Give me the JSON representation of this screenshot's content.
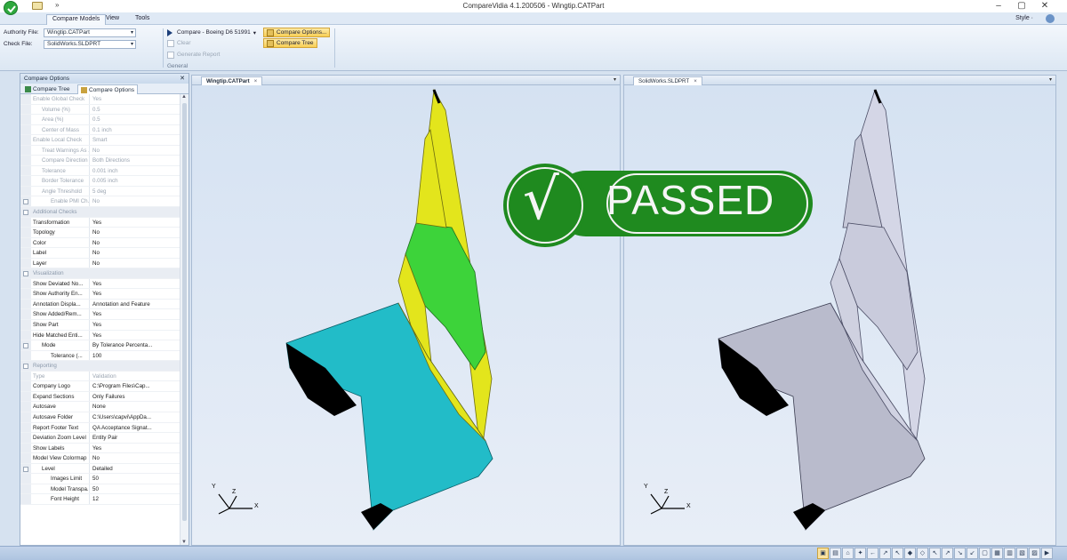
{
  "window": {
    "title": "CompareVidia 4.1.200506 - Wingtip.CATPart",
    "qa_label": "»",
    "min": "–",
    "max": "▢",
    "close": "✕"
  },
  "ribbon_tabs": [
    "Compare Models",
    "View",
    "Tools"
  ],
  "style_label": "Style ·",
  "ribbon": {
    "authority_label": "Authority File:",
    "authority_value": "Wingtip.CATPart",
    "check_label": "Check File:",
    "check_value": "SolidWorks.SLDPRT",
    "compare_label": "Compare - Boeing D6 51991",
    "clear_label": "Clear",
    "generate_report_label": "Generate Report",
    "compare_options_label": "Compare Options...",
    "compare_tree_label": "Compare Tree",
    "group_caption": "General"
  },
  "left_panel": {
    "title": "Compare Options",
    "close": "✕",
    "tabs": [
      "Compare Tree",
      "Compare Options"
    ],
    "rows": [
      {
        "name": "Enable Global Check",
        "value": "Yes",
        "indent": 0,
        "disabled": true,
        "cat": false
      },
      {
        "name": "Volume (%)",
        "value": "0.5",
        "indent": 1,
        "disabled": true,
        "cat": false
      },
      {
        "name": "Area (%)",
        "value": "0.5",
        "indent": 1,
        "disabled": true,
        "cat": false
      },
      {
        "name": "Center of Mass",
        "value": "0.1 inch",
        "indent": 1,
        "disabled": true,
        "cat": false
      },
      {
        "name": "Enable Local Check",
        "value": "Smart",
        "indent": 0,
        "disabled": true,
        "cat": false
      },
      {
        "name": "Treat Warnings As ...",
        "value": "No",
        "indent": 1,
        "disabled": true,
        "cat": false
      },
      {
        "name": "Compare Direction",
        "value": "Both Directions",
        "indent": 1,
        "disabled": true,
        "cat": false
      },
      {
        "name": "Tolerance",
        "value": "0.001 inch",
        "indent": 1,
        "disabled": true,
        "cat": false
      },
      {
        "name": "Border Tolerance",
        "value": "0.005 inch",
        "indent": 1,
        "disabled": true,
        "cat": false
      },
      {
        "name": "Angle Threshold",
        "value": "5 deg",
        "indent": 1,
        "disabled": true,
        "cat": false
      },
      {
        "name": "Enable PMI Ch...",
        "value": "No",
        "indent": 2,
        "disabled": true,
        "cat": false
      },
      {
        "name": "Additional Checks",
        "value": "",
        "indent": 0,
        "disabled": true,
        "cat": true
      },
      {
        "name": "Transformation",
        "value": "Yes",
        "indent": 0,
        "disabled": false,
        "cat": false
      },
      {
        "name": "Topology",
        "value": "No",
        "indent": 0,
        "disabled": false,
        "cat": false
      },
      {
        "name": "Color",
        "value": "No",
        "indent": 0,
        "disabled": false,
        "cat": false
      },
      {
        "name": "Label",
        "value": "No",
        "indent": 0,
        "disabled": false,
        "cat": false
      },
      {
        "name": "Layer",
        "value": "No",
        "indent": 0,
        "disabled": false,
        "cat": false
      },
      {
        "name": "Visualization",
        "value": "",
        "indent": 0,
        "disabled": true,
        "cat": true
      },
      {
        "name": "Show Deviated No...",
        "value": "Yes",
        "indent": 0,
        "disabled": false,
        "cat": false
      },
      {
        "name": "Show Authority En...",
        "value": "Yes",
        "indent": 0,
        "disabled": false,
        "cat": false
      },
      {
        "name": "Annotation Displa...",
        "value": "Annotation and Feature",
        "indent": 0,
        "disabled": false,
        "cat": false
      },
      {
        "name": "Show Added/Rem...",
        "value": "Yes",
        "indent": 0,
        "disabled": false,
        "cat": false
      },
      {
        "name": "Show Part",
        "value": "Yes",
        "indent": 0,
        "disabled": false,
        "cat": false
      },
      {
        "name": "Hide Matched Enti...",
        "value": "Yes",
        "indent": 0,
        "disabled": false,
        "cat": false
      },
      {
        "name": "Mode",
        "value": "By Tolerance Percenta...",
        "indent": 1,
        "disabled": false,
        "cat": false
      },
      {
        "name": "Tolerance (...",
        "value": "100",
        "indent": 2,
        "disabled": false,
        "cat": false
      },
      {
        "name": "Reporting",
        "value": "",
        "indent": 0,
        "disabled": true,
        "cat": true
      },
      {
        "name": "Type",
        "value": "Validation",
        "indent": 0,
        "disabled": true,
        "cat": false
      },
      {
        "name": "Company Logo",
        "value": "C:\\Program Files\\Cap...",
        "indent": 0,
        "disabled": false,
        "cat": false
      },
      {
        "name": "Expand Sections",
        "value": "Only Failures",
        "indent": 0,
        "disabled": false,
        "cat": false
      },
      {
        "name": "Autosave",
        "value": "None",
        "indent": 0,
        "disabled": false,
        "cat": false
      },
      {
        "name": "Autosave Folder",
        "value": "C:\\Users\\capvi\\AppDa...",
        "indent": 0,
        "disabled": false,
        "cat": false
      },
      {
        "name": "Report Footer Text",
        "value": "QA Acceptance Signat...",
        "indent": 0,
        "disabled": false,
        "cat": false
      },
      {
        "name": "Deviation Zoom Level",
        "value": "Entity Pair",
        "indent": 0,
        "disabled": false,
        "cat": false
      },
      {
        "name": "Show Labels",
        "value": "Yes",
        "indent": 0,
        "disabled": false,
        "cat": false
      },
      {
        "name": "Model View Colormap",
        "value": "No",
        "indent": 0,
        "disabled": false,
        "cat": false
      },
      {
        "name": "Level",
        "value": "Detailed",
        "indent": 1,
        "disabled": false,
        "cat": false
      },
      {
        "name": "Images Limit",
        "value": "50",
        "indent": 2,
        "disabled": false,
        "cat": false
      },
      {
        "name": "Model Transpa...",
        "value": "50",
        "indent": 2,
        "disabled": false,
        "cat": false
      },
      {
        "name": "Font Height",
        "value": "12",
        "indent": 2,
        "disabled": false,
        "cat": false
      }
    ]
  },
  "viewports": {
    "left_tab": "Wingtip.CATPart",
    "right_tab": "SolidWorks.SLDPRT",
    "tab_close": "×",
    "dropdown": "▾",
    "triad_y": "Y",
    "triad_z": "Z",
    "triad_x": "X"
  },
  "stamp": {
    "check": "√",
    "text": "PASSED",
    "color": "#1f8a1f"
  },
  "colors": {
    "authority_yellow": "#e3e51c",
    "deviation_green": "#3dd33a",
    "cyan_surface": "#22bcc8",
    "check_part_gray": "#c6c8d8"
  },
  "status_icons": [
    "▣",
    "▤",
    "⌂",
    "✦",
    "←",
    "↗",
    "↖",
    "◆",
    "◇",
    "↖",
    "↗",
    "↘",
    "↙",
    "▢",
    "▦",
    "▥",
    "▧",
    "▨",
    "▶"
  ]
}
